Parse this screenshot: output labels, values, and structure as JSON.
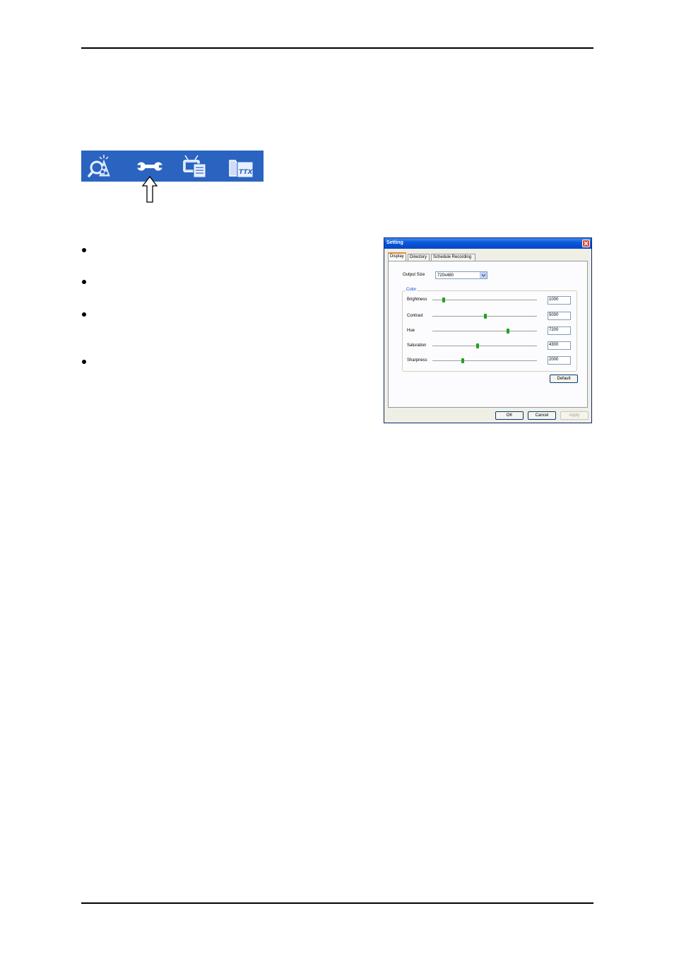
{
  "toolbar": {
    "icons": [
      "channel-scan-icon",
      "settings-wrench-icon",
      "epg-tv-icon",
      "teletext-ttx-icon"
    ],
    "background": "#2a64c0"
  },
  "dialog": {
    "title": "Setting",
    "tabs": [
      "Display",
      "Directory",
      "Schedule Recording"
    ],
    "output_size": {
      "label": "Output Size",
      "value": "720x480"
    },
    "color_group": {
      "label": "Color",
      "rows": [
        {
          "label": "Brightness",
          "value": "1000"
        },
        {
          "label": "Contrast",
          "value": "5000"
        },
        {
          "label": "Hue",
          "value": "7200"
        },
        {
          "label": "Saturation",
          "value": "4300"
        },
        {
          "label": "Sharpness",
          "value": "2000"
        }
      ]
    },
    "default_label": "Default",
    "ok_label": "OK",
    "cancel_label": "Cancel",
    "apply_label": "Apply"
  }
}
